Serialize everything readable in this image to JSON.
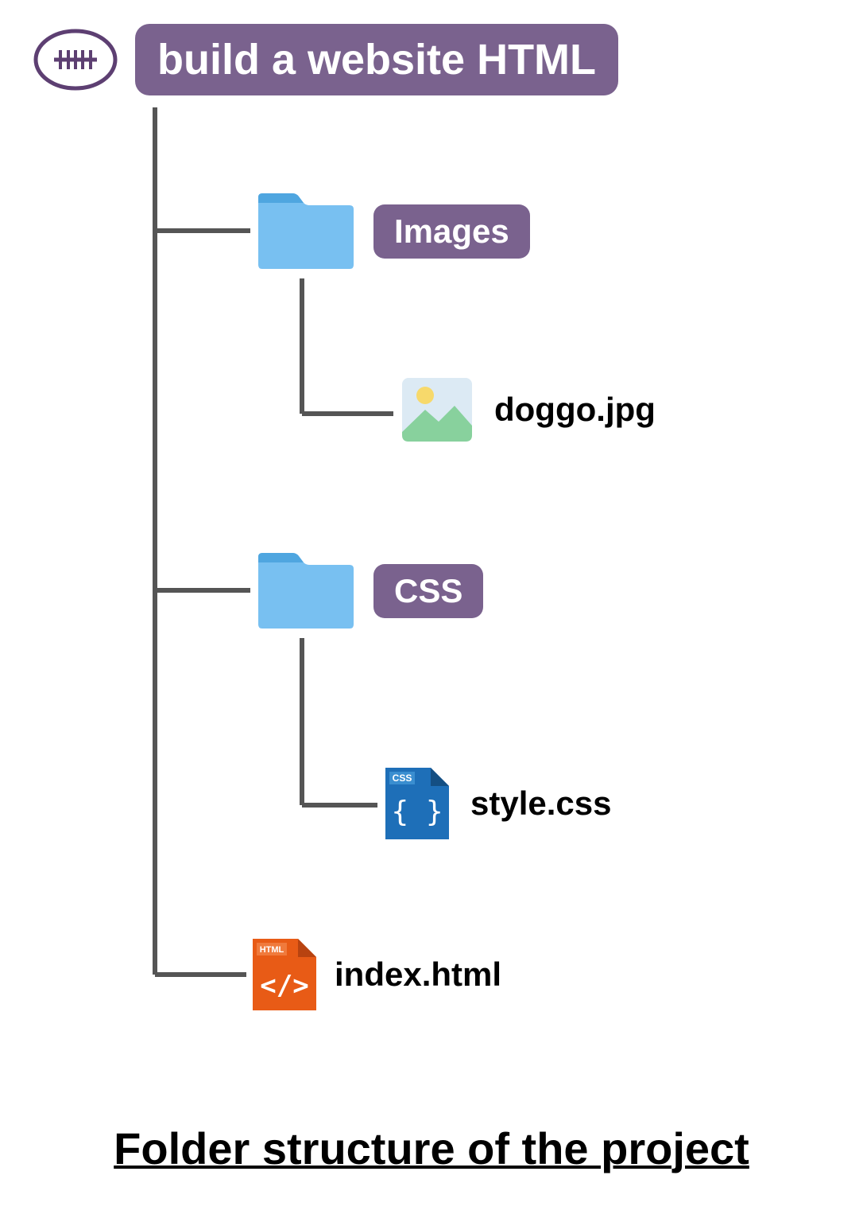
{
  "root": {
    "label": "build a website HTML"
  },
  "folders": {
    "images": {
      "label": "Images"
    },
    "css": {
      "label": "CSS"
    }
  },
  "files": {
    "doggo": {
      "label": "doggo.jpg"
    },
    "style": {
      "label": "style.css"
    },
    "index": {
      "label": "index.html"
    }
  },
  "icons": {
    "cssBadge": "CSS",
    "htmlBadge": "HTML"
  },
  "caption": "Folder structure of the project",
  "colors": {
    "brand": "#7a628e",
    "folder": "#78c0f1",
    "folderTab": "#4fa6e0",
    "cssFile": "#1e6fb8",
    "htmlFile": "#e85b16",
    "connector": "#555555"
  }
}
